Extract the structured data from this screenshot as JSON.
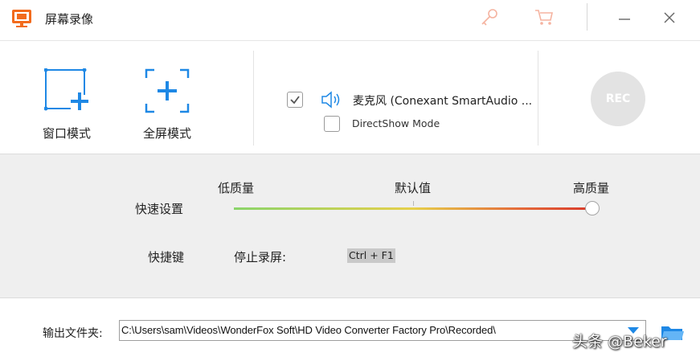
{
  "titlebar": {
    "title": "屏幕录像",
    "icons": [
      "app-icon",
      "key-icon",
      "cart-icon",
      "minimize-icon",
      "close-icon"
    ]
  },
  "modes": {
    "window_label": "窗口模式",
    "fullscreen_label": "全屏模式"
  },
  "audio": {
    "mic_checked": true,
    "mic_label": "麦克风 (Conexant SmartAudio ...",
    "directshow_checked": false,
    "directshow_label": "DirectShow Mode"
  },
  "rec_button": {
    "label": "REC",
    "color": "#e3e3e3"
  },
  "quality": {
    "section_label": "快速设置",
    "low_label": "低质量",
    "default_label": "默认值",
    "high_label": "高质量",
    "level": 1.0
  },
  "hotkey": {
    "section_label": "快捷键",
    "stop_label": "停止录屏:",
    "stop_value": "Ctrl + F1"
  },
  "output": {
    "label": "输出文件夹:",
    "path": "C:\\Users\\sam\\Videos\\WonderFox Soft\\HD Video Converter Factory Pro\\Recorded\\"
  },
  "watermark": "头条 @Beker",
  "colors": {
    "accent_orange": "#f26b1d",
    "accent_blue": "#1e88e5",
    "panel_bg": "#efefef"
  }
}
